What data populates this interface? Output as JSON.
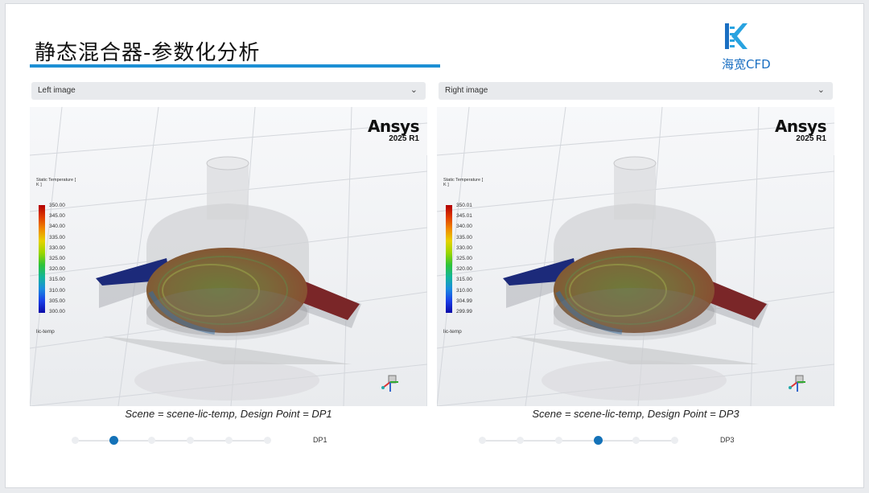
{
  "title": "静态混合器-参数化分析",
  "logo": {
    "text": "海宽CFD",
    "color": "#1a6fc2"
  },
  "accent_color": "#1c8fd4",
  "panels": [
    {
      "select_label": "Left image",
      "brand": "Ansys",
      "version": "2025 R1",
      "legend_title": "Static Temperature [ K ]",
      "legend_ticks": [
        "350.00",
        "345.00",
        "340.00",
        "335.00",
        "330.00",
        "325.00",
        "320.00",
        "315.00",
        "310.00",
        "305.00",
        "300.00"
      ],
      "legend_name": "lic-temp",
      "caption": "Scene = scene-lic-temp, Design Point = DP1",
      "slider_active": 1,
      "dp_label": "DP1"
    },
    {
      "select_label": "Right image",
      "brand": "Ansys",
      "version": "2025 R1",
      "legend_title": "Static Temperature [ K ]",
      "legend_ticks": [
        "350.01",
        "345.01",
        "340.00",
        "335.00",
        "330.00",
        "325.00",
        "320.00",
        "315.00",
        "310.00",
        "304.99",
        "299.99"
      ],
      "legend_name": "lic-temp",
      "caption": "Scene = scene-lic-temp, Design Point = DP3",
      "slider_active": 3,
      "dp_label": "DP3"
    }
  ]
}
